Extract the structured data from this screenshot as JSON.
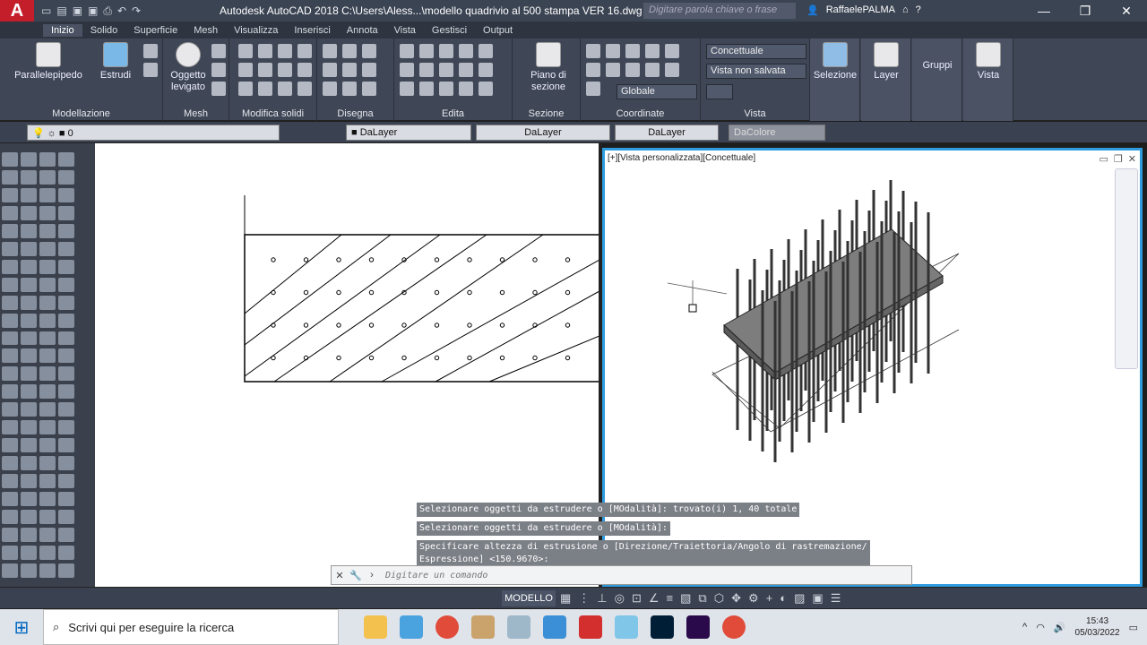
{
  "window": {
    "logo": "A",
    "title": "Autodesk AutoCAD 2018    C:\\Users\\Aless...\\modello quadrivio al 500 stampa VER 16.dwg",
    "search_placeholder": "Digitare parola chiave o frase",
    "user": "RaffaelePALMA"
  },
  "ribbon_tabs": [
    "Inizio",
    "Solido",
    "Superficie",
    "Mesh",
    "Visualizza",
    "Inserisci",
    "Annota",
    "Vista",
    "Gestisci",
    "Output"
  ],
  "panels": {
    "modellazione": {
      "title": "Modellazione",
      "parallelepipedo": "Parallelepipedo",
      "estrudi": "Estrudi"
    },
    "mesh": {
      "title": "Mesh",
      "oggetto_levigato": "Oggetto levigato"
    },
    "modifica_solidi": {
      "title": "Modifica solidi"
    },
    "disegna": {
      "title": "Disegna"
    },
    "edita": {
      "title": "Edita"
    },
    "sezione": {
      "title": "Sezione",
      "piano": "Piano di sezione"
    },
    "coordinate": {
      "title": "Coordinate",
      "ucs": "Globale"
    },
    "vista": {
      "title": "Vista",
      "visual_style": "Concettuale",
      "saved_view": "Vista non salvata"
    },
    "selezione": "Selezione",
    "layer": "Layer",
    "gruppi": "Gruppi",
    "vista_btn": "Vista"
  },
  "properties": {
    "layer": "0",
    "color": "DaLayer",
    "linetype": "DaLayer",
    "lineweight": "DaLayer",
    "plotstyle": "DaColore"
  },
  "viewport": {
    "label": "[+][Vista personalizzata][Concettuale]"
  },
  "command": {
    "history": [
      "Selezionare oggetti da estrudere o [MOdalità]: trovato(i) 1, 40 totale",
      "Selezionare oggetti da estrudere o [MOdalità]:",
      "Specificare altezza di estrusione o [Direzione/Traiettoria/Angolo di rastremazione/\nEspressione] <150.9670>:"
    ],
    "placeholder": "Digitare un comando"
  },
  "statusbar": {
    "model": "MODELLO"
  },
  "taskbar": {
    "search": "Scrivi qui per eseguire la ricerca",
    "time": "15:43",
    "date": "05/03/2022"
  },
  "colors": {
    "accent": "#2f9bdf",
    "logo": "#c41e2a"
  }
}
